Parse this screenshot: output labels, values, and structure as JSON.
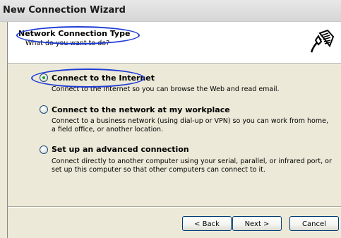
{
  "window": {
    "title": "New Connection Wizard"
  },
  "header": {
    "title": "Network Connection Type",
    "subtitle": "What do you want to do?",
    "icon": "network-cable-icon"
  },
  "options": [
    {
      "label": "Connect to the Internet",
      "selected": true,
      "description": [
        "Connect to the Internet so you can browse the Web and read email."
      ]
    },
    {
      "label": "Connect to the network at my workplace",
      "selected": false,
      "description": [
        "Connect to a business network (using dial-up or VPN) so you can work from home,",
        "a field office, or another location."
      ]
    },
    {
      "label": "Set up an advanced connection",
      "selected": false,
      "description": [
        "Connect directly to another computer using your serial, parallel, or infrared port, or",
        "set up this computer so that other computers can connect to it."
      ]
    }
  ],
  "buttons": {
    "back": "< Back",
    "next": "Next >",
    "cancel": "Cancel"
  },
  "annotation_color": "#1f3cd6"
}
